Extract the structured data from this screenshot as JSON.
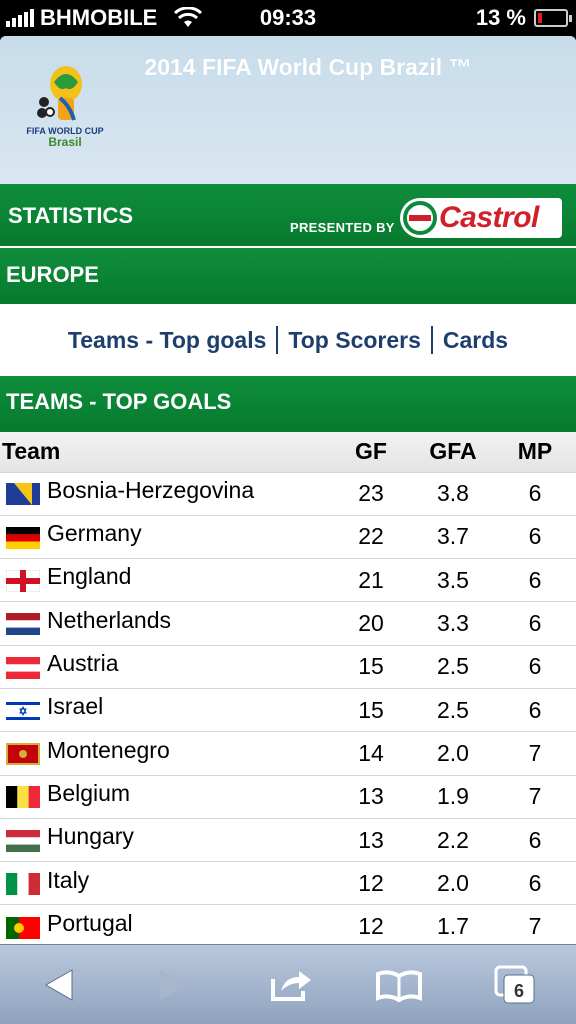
{
  "status_bar": {
    "carrier": "BHMOBILE",
    "time": "09:33",
    "battery": "13 %"
  },
  "header": {
    "title": "2014 FIFA World Cup Brazil ™",
    "logo_line1": "FIFA WORLD CUP",
    "logo_line2": "Brasil"
  },
  "sponsor": {
    "section_label": "STATISTICS",
    "presented_by": "PRESENTED BY",
    "brand": "Castrol"
  },
  "region": "EUROPE",
  "subnav": {
    "teams_top_goals": "Teams - Top goals",
    "top_scorers": "Top Scorers",
    "cards": "Cards"
  },
  "section_title": "TEAMS - TOP GOALS",
  "table": {
    "headers": {
      "team": "Team",
      "gf": "GF",
      "gfa": "GFA",
      "mp": "MP"
    },
    "rows": [
      {
        "team": "Bosnia-Herzegovina",
        "flag": "bosnia-flag-icon",
        "gf": "23",
        "gfa": "3.8",
        "mp": "6"
      },
      {
        "team": "Germany",
        "flag": "germany-flag-icon",
        "gf": "22",
        "gfa": "3.7",
        "mp": "6"
      },
      {
        "team": "England",
        "flag": "england-flag-icon",
        "gf": "21",
        "gfa": "3.5",
        "mp": "6"
      },
      {
        "team": "Netherlands",
        "flag": "netherlands-flag-icon",
        "gf": "20",
        "gfa": "3.3",
        "mp": "6"
      },
      {
        "team": "Austria",
        "flag": "austria-flag-icon",
        "gf": "15",
        "gfa": "2.5",
        "mp": "6"
      },
      {
        "team": "Israel",
        "flag": "israel-flag-icon",
        "gf": "15",
        "gfa": "2.5",
        "mp": "6"
      },
      {
        "team": "Montenegro",
        "flag": "montenegro-flag-icon",
        "gf": "14",
        "gfa": "2.0",
        "mp": "7"
      },
      {
        "team": "Belgium",
        "flag": "belgium-flag-icon",
        "gf": "13",
        "gfa": "1.9",
        "mp": "7"
      },
      {
        "team": "Hungary",
        "flag": "hungary-flag-icon",
        "gf": "13",
        "gfa": "2.2",
        "mp": "6"
      },
      {
        "team": "Italy",
        "flag": "italy-flag-icon",
        "gf": "12",
        "gfa": "2.0",
        "mp": "6"
      },
      {
        "team": "Portugal",
        "flag": "portugal-flag-icon",
        "gf": "12",
        "gfa": "1.7",
        "mp": "7"
      }
    ]
  },
  "toolbar": {
    "tabs_count": "6"
  },
  "colors": {
    "green": "#0f8e3c",
    "nav_blue": "#1e3f6e",
    "castrol_red": "#d0202a"
  }
}
